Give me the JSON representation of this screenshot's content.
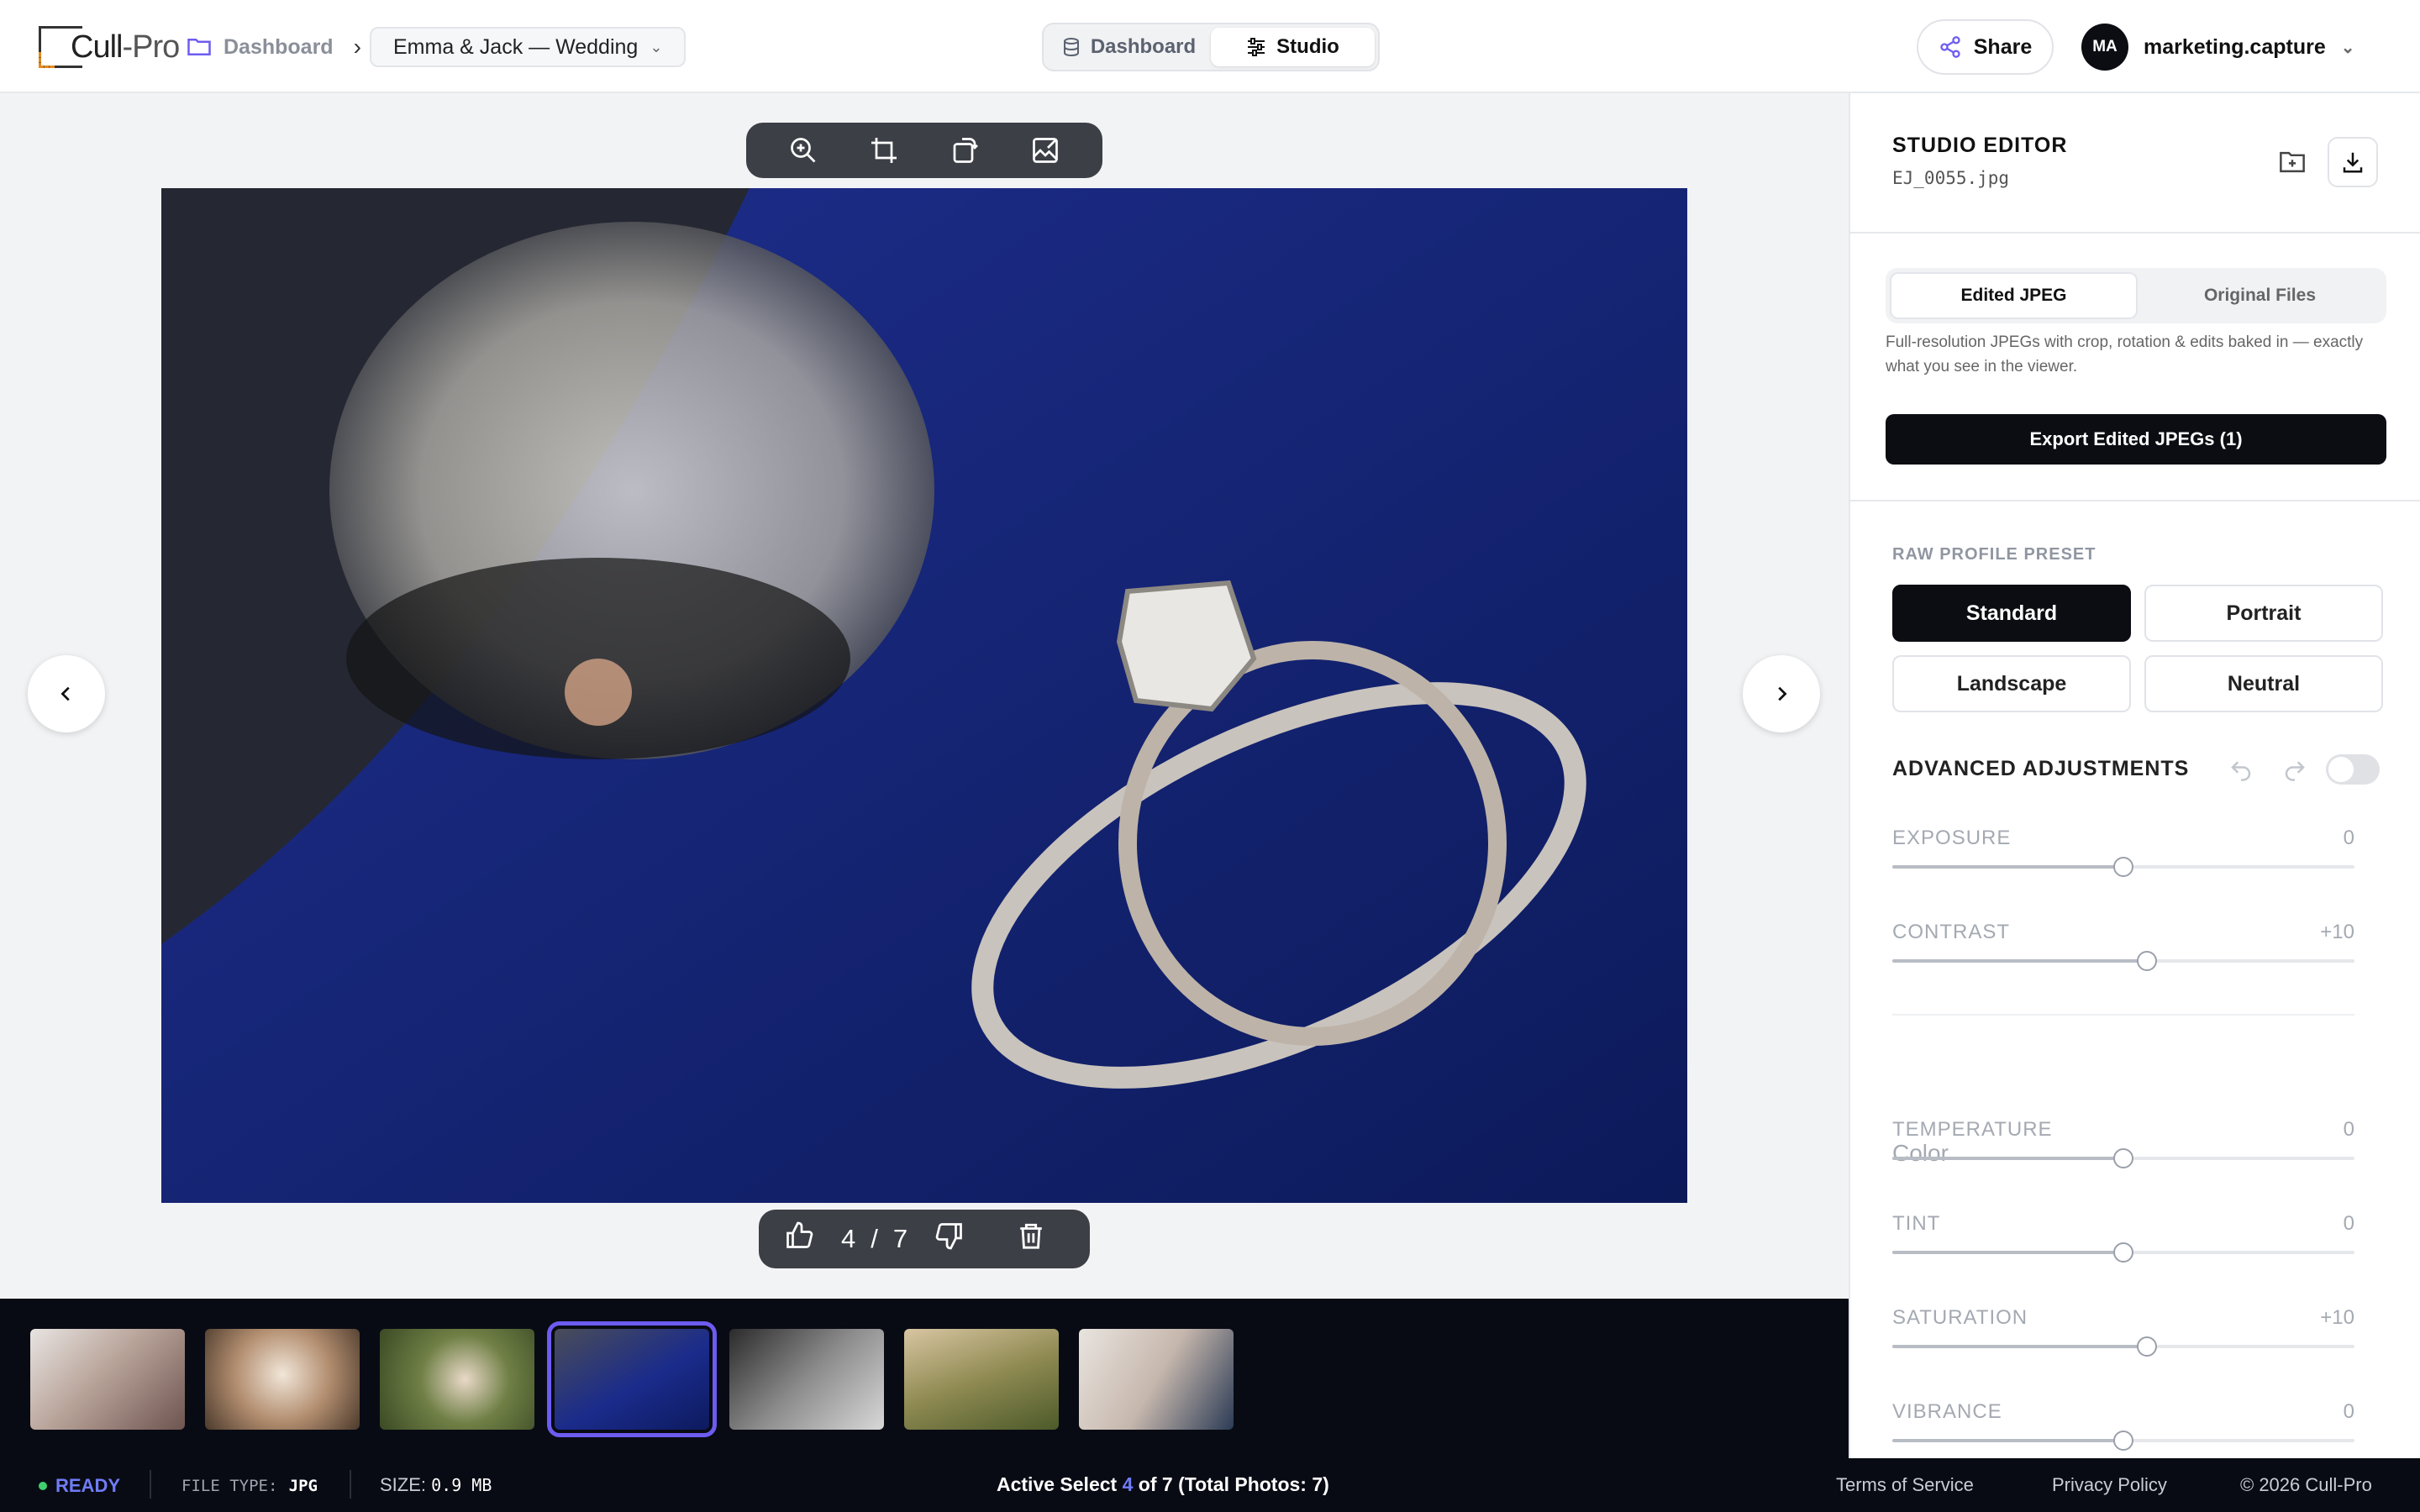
{
  "header": {
    "logo_main": "Cull",
    "logo_suffix": "-Pro",
    "breadcrumb_root": "Dashboard",
    "project": "Emma & Jack — Wedding",
    "mode_tabs": [
      {
        "label": "Dashboard",
        "active": false
      },
      {
        "label": "Studio",
        "active": true
      }
    ],
    "share_label": "Share",
    "avatar_initials": "MA",
    "account": "marketing.capture"
  },
  "viewer": {
    "counter_current": "4",
    "counter_sep": "/",
    "counter_total": "7",
    "thumbnails": 7,
    "selected_index": 4
  },
  "panel": {
    "title": "STUDIO EDITOR",
    "filename": "EJ_0055.jpg",
    "export_tabs": [
      "Edited JPEG",
      "Original Files"
    ],
    "description": "Full-resolution JPEGs with crop, rotation & edits baked in — exactly what you see in the viewer.",
    "export_button": "Export Edited JPEGs (1)",
    "preset_label": "RAW PROFILE PRESET",
    "presets": [
      "Standard",
      "Portrait",
      "Landscape",
      "Neutral"
    ],
    "advanced_label": "ADVANCED ADJUSTMENTS",
    "sliders": [
      {
        "name": "EXPOSURE",
        "value": "0",
        "level": 0.5
      },
      {
        "name": "CONTRAST",
        "value": "+10",
        "level": 0.55
      }
    ],
    "color_label": "Color",
    "color_sliders": [
      {
        "name": "TEMPERATURE",
        "value": "0",
        "level": 0.5
      },
      {
        "name": "TINT",
        "value": "0",
        "level": 0.5
      },
      {
        "name": "SATURATION",
        "value": "+10",
        "level": 0.55
      },
      {
        "name": "VIBRANCE",
        "value": "0",
        "level": 0.5
      }
    ]
  },
  "status": {
    "ready": "READY",
    "file_type_label": "FILE TYPE:",
    "file_type": "JPG",
    "size_label": "SIZE:",
    "size": "0.9 MB",
    "active_prefix": "Active Select",
    "active_num": "4",
    "active_of": "of",
    "active_total": "7",
    "active_suffix": "(Total Photos: 7)",
    "links": [
      "Terms of Service",
      "Privacy Policy",
      "© 2026 Cull-Pro"
    ]
  },
  "colors": {
    "accent": "#6d5cf0",
    "dark": "#0b0d12",
    "ready_dot": "#3fcf6f"
  }
}
